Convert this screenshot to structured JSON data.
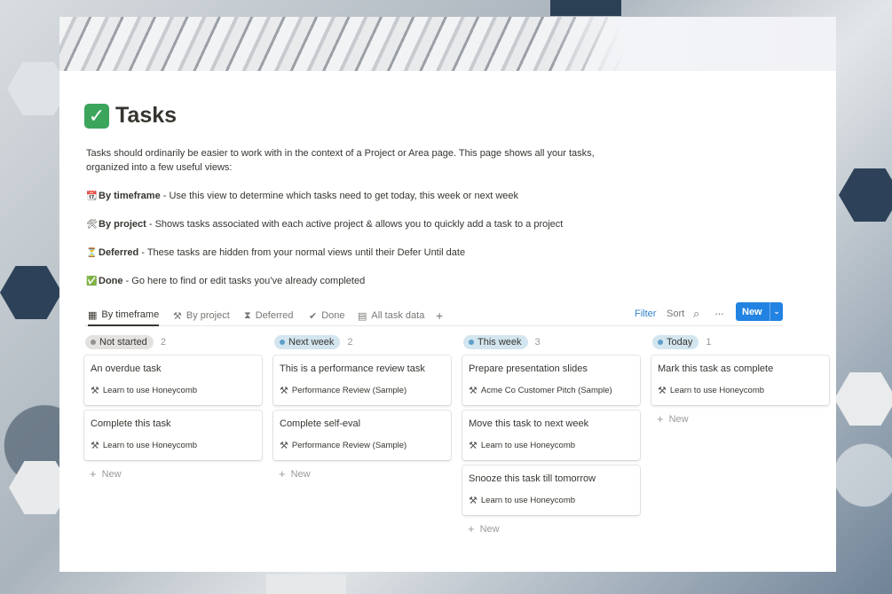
{
  "page": {
    "title_icon": "✓",
    "title": "Tasks",
    "intro": "Tasks should ordinarily be easier to work with in the context of a Project or Area page. This page shows all your tasks, organized into a few useful views:",
    "views": [
      {
        "emoji": "📆",
        "name": "By timeframe",
        "text": " - Use this view to determine which tasks need to get today, this week or next week"
      },
      {
        "emoji": "🛠",
        "name": "By project",
        "text": " - Shows tasks associated with each active project & allows you to quickly add a task to a project"
      },
      {
        "emoji": "⏳",
        "name": "Deferred",
        "text": " - These tasks are hidden from your normal views until their Defer Until date"
      },
      {
        "emoji": "✅",
        "name": "Done",
        "text": " - Go here to find or edit tasks you’ve already completed"
      }
    ]
  },
  "tabs": [
    {
      "label": "By timeframe",
      "icon": "calendar-icon"
    },
    {
      "label": "By project",
      "icon": "hammer-icon"
    },
    {
      "label": "Deferred",
      "icon": "hourglass-icon"
    },
    {
      "label": "Done",
      "icon": "check-circle-icon"
    },
    {
      "label": "All task data",
      "icon": "table-icon"
    }
  ],
  "toolbar": {
    "filter": "Filter",
    "sort": "Sort",
    "new": "New"
  },
  "columns": [
    {
      "label": "Not started",
      "count": "2",
      "pill_bg": "#e3e2e0",
      "dot": "#91918e",
      "cards": [
        {
          "title": "An overdue task",
          "project": "Learn to use Honeycomb"
        },
        {
          "title": "Complete this task",
          "project": "Learn to use Honeycomb"
        }
      ],
      "new_label": "New"
    },
    {
      "label": "Next week",
      "count": "2",
      "pill_bg": "#d3e5ef",
      "dot": "#5e9fc9",
      "cards": [
        {
          "title": "This is a performance review task",
          "project": "Performance Review (Sample)"
        },
        {
          "title": "Complete self-eval",
          "project": "Performance Review (Sample)"
        }
      ],
      "new_label": "New"
    },
    {
      "label": "This week",
      "count": "3",
      "pill_bg": "#d3e5ef",
      "dot": "#5e9fc9",
      "cards": [
        {
          "title": "Prepare presentation slides",
          "project": "Acme Co Customer Pitch (Sample)"
        },
        {
          "title": "Move this task to next week",
          "project": "Learn to use Honeycomb"
        },
        {
          "title": "Snooze this task till tomorrow",
          "project": "Learn to use Honeycomb"
        }
      ],
      "new_label": "New"
    },
    {
      "label": "Today",
      "count": "1",
      "pill_bg": "#d3e5ef",
      "dot": "#5e9fc9",
      "cards": [
        {
          "title": "Mark this task as complete",
          "project": "Learn to use Honeycomb"
        }
      ],
      "new_label": "New"
    }
  ]
}
